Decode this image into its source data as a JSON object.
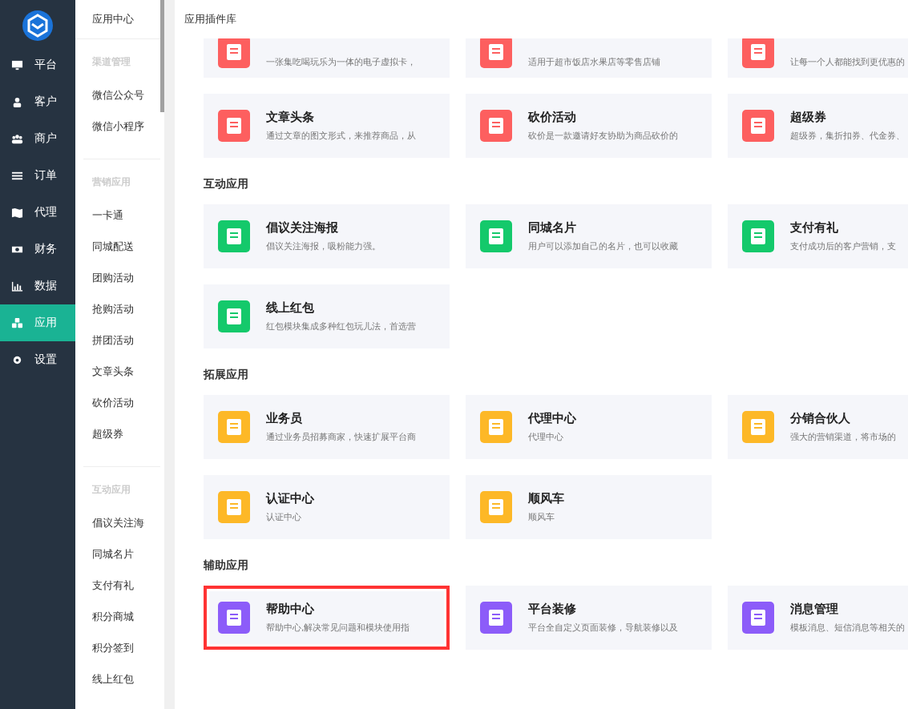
{
  "nav": {
    "items": [
      {
        "label": "平台",
        "selected": false
      },
      {
        "label": "客户",
        "selected": false
      },
      {
        "label": "商户",
        "selected": false
      },
      {
        "label": "订单",
        "selected": false
      },
      {
        "label": "代理",
        "selected": false
      },
      {
        "label": "财务",
        "selected": false
      },
      {
        "label": "数据",
        "selected": false
      },
      {
        "label": "应用",
        "selected": true
      },
      {
        "label": "设置",
        "selected": false
      }
    ]
  },
  "submenu": {
    "title": "应用中心",
    "groups": [
      {
        "title": "渠道管理",
        "items": [
          "微信公众号",
          "微信小程序"
        ]
      },
      {
        "title": "营销应用",
        "items": [
          "一卡通",
          "同城配送",
          "团购活动",
          "抢购活动",
          "拼团活动",
          "文章头条",
          "砍价活动",
          "超级券"
        ]
      },
      {
        "title": "互动应用",
        "items": [
          "倡议关注海",
          "同城名片",
          "支付有礼",
          "积分商城",
          "积分签到",
          "线上红包"
        ]
      }
    ]
  },
  "header": {
    "title": "应用插件库"
  },
  "sections": [
    {
      "color": "#fd5f5f",
      "cards": [
        {
          "kind": "partial",
          "desc": "一张集吃喝玩乐为一体的电子虚拟卡，",
          "highlighted": false
        },
        {
          "kind": "partial",
          "desc": "适用于超市饭店水果店等零售店铺",
          "highlighted": false
        },
        {
          "kind": "partial",
          "desc": "让每一个人都能找到更优惠的",
          "highlighted": false
        },
        {
          "kind": "full",
          "title": "文章头条",
          "desc": "通过文章的图文形式，来推荐商品，从",
          "highlighted": false
        },
        {
          "kind": "full",
          "title": "砍价活动",
          "desc": "砍价是一款邀请好友协助为商品砍价的",
          "highlighted": false
        },
        {
          "kind": "full",
          "title": "超级券",
          "desc": "超级券，集折扣券、代金券、",
          "highlighted": false
        }
      ]
    },
    {
      "title": "互动应用",
      "color": "#14c96b",
      "cards": [
        {
          "kind": "full",
          "title": "倡议关注海报",
          "desc": "倡议关注海报，吸粉能力强。",
          "highlighted": false
        },
        {
          "kind": "full",
          "title": "同城名片",
          "desc": "用户可以添加自己的名片，也可以收藏",
          "highlighted": false
        },
        {
          "kind": "full",
          "title": "支付有礼",
          "desc": "支付成功后的客户营销，支",
          "highlighted": false
        },
        {
          "kind": "full",
          "title": "线上红包",
          "desc": "红包模块集成多种红包玩儿法，首选营",
          "highlighted": false
        }
      ]
    },
    {
      "title": "拓展应用",
      "color": "#fdb827",
      "cards": [
        {
          "kind": "full",
          "title": "业务员",
          "desc": "通过业务员招募商家，快速扩展平台商",
          "highlighted": false
        },
        {
          "kind": "full",
          "title": "代理中心",
          "desc": "代理中心",
          "highlighted": false
        },
        {
          "kind": "full",
          "title": "分销合伙人",
          "desc": "强大的营销渠道，将市场的",
          "highlighted": false
        },
        {
          "kind": "full",
          "title": "认证中心",
          "desc": "认证中心",
          "highlighted": false
        },
        {
          "kind": "full",
          "title": "顺风车",
          "desc": "顺风车",
          "highlighted": false
        }
      ]
    },
    {
      "title": "辅助应用",
      "color": "#8c5cf9",
      "cards": [
        {
          "kind": "full",
          "title": "帮助中心",
          "desc": "帮助中心,解决常见问题和模块使用指",
          "highlighted": true
        },
        {
          "kind": "full",
          "title": "平台装修",
          "desc": "平台全自定义页面装修，导航装修以及",
          "highlighted": false
        },
        {
          "kind": "full",
          "title": "消息管理",
          "desc": "模板消息、短信消息等相关的",
          "highlighted": false
        }
      ]
    }
  ]
}
